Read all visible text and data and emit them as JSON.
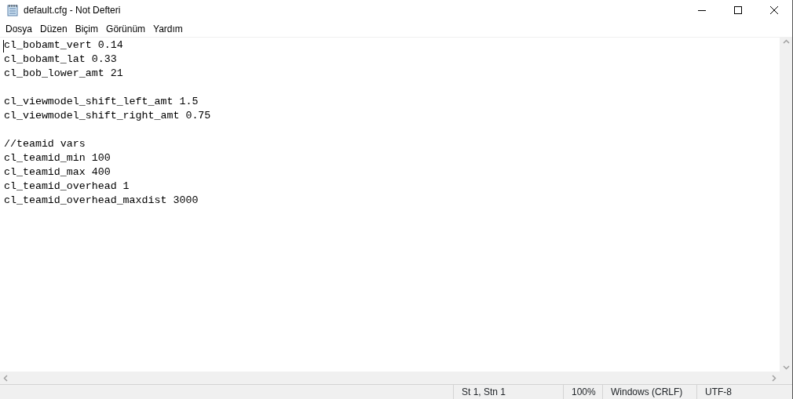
{
  "window": {
    "title": "default.cfg - Not Defteri"
  },
  "menu": [
    "Dosya",
    "Düzen",
    "Biçim",
    "Görünüm",
    "Yardım"
  ],
  "editor": {
    "paragraphs": [
      [
        "cl_bobamt_vert 0.14",
        "cl_bobamt_lat 0.33",
        "cl_bob_lower_amt 21"
      ],
      [
        "cl_viewmodel_shift_left_amt 1.5",
        "cl_viewmodel_shift_right_amt 0.75"
      ],
      [
        "//teamid vars",
        "cl_teamid_min 100",
        "cl_teamid_max 400",
        "cl_teamid_overhead 1",
        "cl_teamid_overhead_maxdist 3000"
      ]
    ]
  },
  "status_bar": [
    "St 1, Stn 1",
    "100%",
    "Windows (CRLF)",
    "UTF-8"
  ]
}
